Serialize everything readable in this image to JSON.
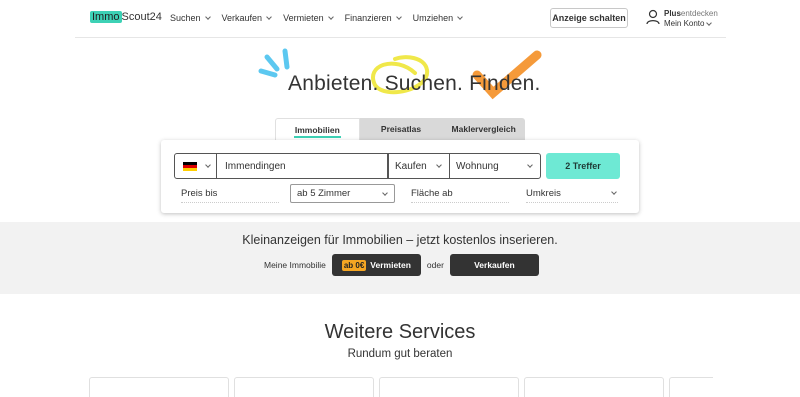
{
  "header": {
    "logo_part1": "Immo",
    "logo_part2": "Scout24",
    "nav": [
      {
        "label": "Suchen"
      },
      {
        "label": "Verkaufen"
      },
      {
        "label": "Vermieten"
      },
      {
        "label": "Finanzieren"
      },
      {
        "label": "Umziehen"
      }
    ],
    "cta_label": "Anzeige schalten",
    "account": {
      "plus": "Plus",
      "discover": "entdecken",
      "label": "Mein Konto"
    }
  },
  "hero": {
    "tagline": "Anbieten. Suchen. Finden."
  },
  "tabs": [
    {
      "label": "Immobilien",
      "active": true
    },
    {
      "label": "Preisatlas",
      "active": false
    },
    {
      "label": "Maklervergleich",
      "active": false
    }
  ],
  "search": {
    "location_value": "Immendingen",
    "transaction_value": "Kaufen",
    "type_value": "Wohnung",
    "submit_label": "2 Treffer",
    "price_label": "Preis bis",
    "rooms_value": "ab 5 Zimmer",
    "area_label": "Fläche ab",
    "radius_label": "Umkreis"
  },
  "banner": {
    "title": "Kleinanzeigen für Immobilien – jetzt kostenlos inserieren.",
    "prefix": "Meine Immobilie",
    "rent_badge": "ab 0€",
    "rent_label": "Vermieten",
    "or_label": "oder",
    "sell_label": "Verkaufen"
  },
  "services": {
    "title": "Weitere Services",
    "subtitle": "Rundum gut beraten"
  },
  "colors": {
    "brand_teal": "#3dd1b5",
    "submit_bg": "#6ee9d4",
    "accent_orange": "#f5a623",
    "dark_button": "#333333"
  }
}
